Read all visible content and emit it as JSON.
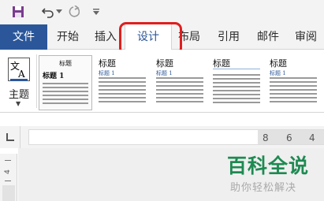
{
  "qat": {
    "icons": [
      "save-icon",
      "undo-icon",
      "redo-icon",
      "customize-arrow-icon"
    ]
  },
  "tabs": {
    "file": "文件",
    "home": "开始",
    "insert": "插入",
    "design": "设计",
    "layout": "布局",
    "references": "引用",
    "mailings": "邮件",
    "review": "审阅"
  },
  "ribbon": {
    "themes_label": "主题",
    "style_set": [
      {
        "title": "标题",
        "heading": "标题 1",
        "selected": true
      },
      {
        "title": "标题",
        "heading": "标题 1",
        "selected": false
      },
      {
        "title": "标题",
        "heading": "标题 1",
        "selected": false
      },
      {
        "title": "标题",
        "heading": "",
        "selected": false
      },
      {
        "title": "标题",
        "heading": "标题 1",
        "selected": false
      }
    ]
  },
  "ruler": {
    "numbers": [
      "8",
      "6",
      "4"
    ],
    "vertical_number": "4"
  },
  "watermark": {
    "brand": "百科全说",
    "tagline": "助你轻松解决"
  },
  "colors": {
    "accent": "#2b579a",
    "highlight": "#e01e1e",
    "watermark_green": "#1e8a52"
  }
}
